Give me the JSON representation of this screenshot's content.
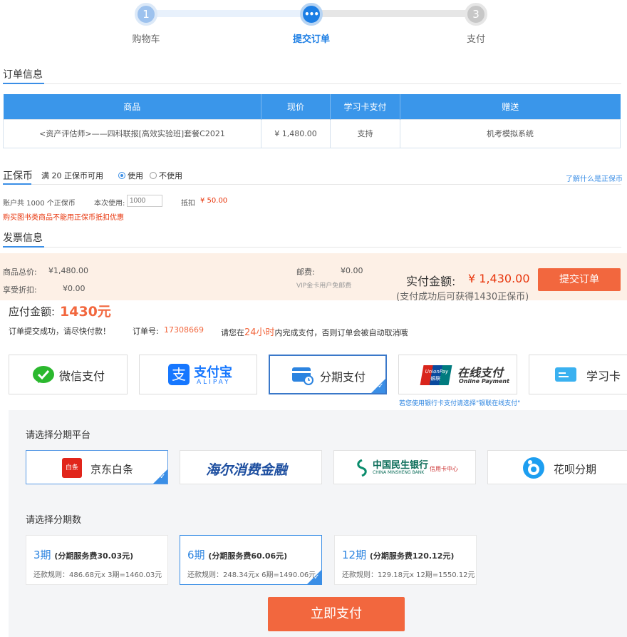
{
  "steps": [
    {
      "num": "1",
      "label": "购物车"
    },
    {
      "num": "•••",
      "label": "提交订单"
    },
    {
      "num": "3",
      "label": "支付"
    }
  ],
  "order_info": {
    "title": "订单信息",
    "columns": [
      "商品",
      "现价",
      "学习卡支付",
      "赠送"
    ],
    "row": {
      "product": "<资产评估师>——四科联报[高效实验班]套餐C2021",
      "price": "¥ 1,480.00",
      "card_pay": "支持",
      "gift": "机考模拟系统"
    }
  },
  "coins": {
    "title": "正保币",
    "rule": "满 20 正保币可用",
    "option_use": "使用",
    "option_nouse": "不使用",
    "help_link": "了解什么是正保币",
    "account_text": "账户共 1000 个正保币",
    "use_label": "本次使用:",
    "use_placeholder": "1000",
    "deduct_label": "抵扣",
    "deduct_value": "¥ 50.00",
    "warning": "购买图书类商品不能用正保币抵扣优惠"
  },
  "invoice": {
    "title": "发票信息"
  },
  "summary": {
    "total_label": "商品总价:",
    "total_value": "¥1,480.00",
    "discount_label": "享受折扣:",
    "discount_value": "¥0.00",
    "postage_label": "邮费:",
    "postage_value": "¥0.00",
    "vip_note": "VIP金卡用户免邮费",
    "actual_label": "实付金额:",
    "actual_value": "¥ 1,430.00",
    "coin_note": "(支付成功后可获得1430正保币)",
    "submit_label": "提交订单"
  },
  "payment": {
    "due_label": "应付金额:",
    "due_value": "1430元",
    "success_msg": "订单提交成功，请尽快付款！",
    "order_no_label": "订单号:",
    "order_no": "17308669",
    "deadline_pre": "请您在",
    "deadline_time": "24小时",
    "deadline_post": "内完成支付，否则订单会被自动取消哦",
    "methods": [
      "微信支付",
      "支付宝",
      "分期支付",
      "在线支付",
      "学习卡"
    ],
    "alipay_sub": "ALIPAY",
    "unionpay_sub": "Online Payment",
    "unionpay_badge": "UnionPay 银联",
    "bank_tip": "若您使用银行卡支付请选择\"银联在线支付\""
  },
  "installment": {
    "platform_title": "请选择分期平台",
    "platforms": [
      "京东白条",
      "海尔消费金融",
      "中国民生银行",
      "花呗分期"
    ],
    "jd_icon_text": "白条",
    "minsheng_sub": "CHINA MINSHENG BANK",
    "minsheng_card": "信用卡中心",
    "period_title": "请选择分期数",
    "periods": [
      {
        "n": "3期",
        "fee": "(分期服务费30.03元)",
        "rule": "还款规则：486.68元x 3期=1460.03元"
      },
      {
        "n": "6期",
        "fee": "(分期服务费60.06元)",
        "rule": "还款规则：248.34元x 6期=1490.06元"
      },
      {
        "n": "12期",
        "fee": "(分期服务费120.12元)",
        "rule": "还款规则：129.18元x 12期=1550.12元"
      }
    ],
    "pay_button": "立即支付"
  },
  "colors": {
    "accent": "#3a8ee6",
    "orange": "#f2673e",
    "red": "#e8350c"
  }
}
